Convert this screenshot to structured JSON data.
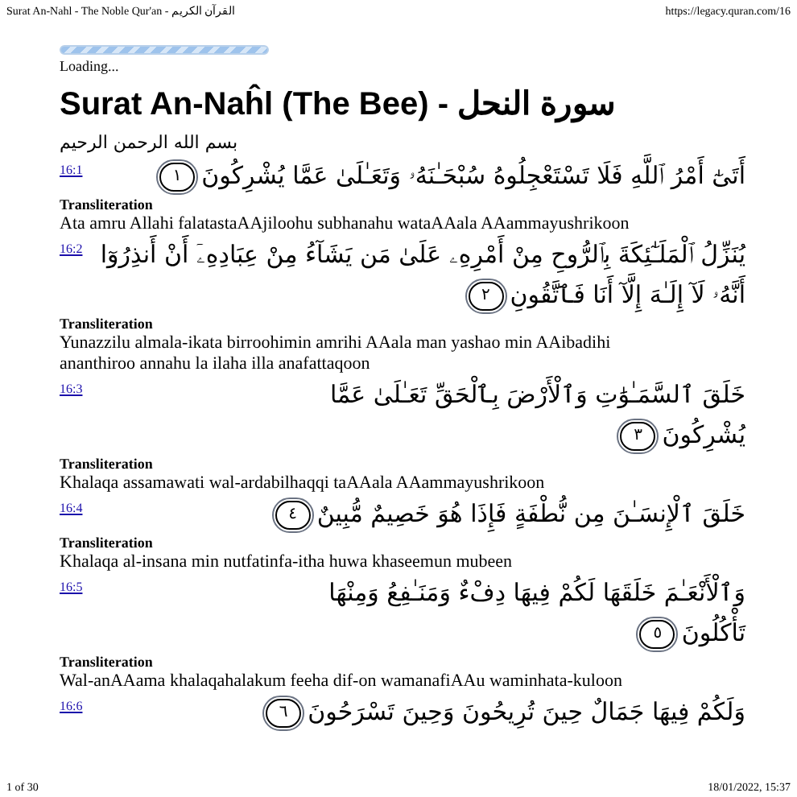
{
  "print_header": {
    "title": "Surat An-Nahl - The Noble Qur'an - القرآن الكريم",
    "url": "https://legacy.quran.com/16"
  },
  "loading": {
    "text": "Loading..."
  },
  "heading": {
    "title": "Surat An-Naĥl (The Bee) - سورة النحل"
  },
  "bismillah": "بسم الله الرحمن الرحيم",
  "verses": [
    {
      "ref": "16:1",
      "lines": [
        "أَتَىٰٓ أَمْرُ ٱللَّهِ فَلَا تَسْتَعْجِلُوهُ سُبْحَـٰنَهُۥ وَتَعَـٰلَىٰ عَمَّا يُشْرِكُونَ"
      ],
      "number": "١",
      "transliteration_label": "Transliteration",
      "transliteration": "Ata amru Allahi falatastaAAjiloohu subhanahu wataAAala AAammayushrikoon"
    },
    {
      "ref": "16:2",
      "lines": [
        "يُنَزِّلُ ٱلْمَلَـٰٓئِكَةَ بِٱلرُّوحِ مِنْ أَمْرِهِۦ عَلَىٰ مَن يَشَآءُ مِنْ عِبَادِهِۦٓ أَنْ أَنذِرُوٓا",
        "أَنَّهُۥ لَآ إِلَـٰهَ إِلَّآ أَنَا فَٱتَّقُونِ"
      ],
      "number": "٢",
      "transliteration_label": "Transliteration",
      "transliteration": "Yunazzilu almala-ikata birroohimin amrihi AAala man yashao min AAibadihi ananthiroo annahu la ilaha illa anafattaqoon"
    },
    {
      "ref": "16:3",
      "lines": [
        "خَلَقَ ٱلسَّمَـٰوَٰتِ وَٱلْأَرْضَ بِٱلْحَقِّ تَعَـٰلَىٰ عَمَّا",
        "يُشْرِكُونَ"
      ],
      "number": "٣",
      "transliteration_label": "Transliteration",
      "transliteration": "Khalaqa assamawati wal-ardabilhaqqi taAAala AAammayushrikoon"
    },
    {
      "ref": "16:4",
      "lines": [
        "خَلَقَ ٱلْإِنسَـٰنَ مِن نُّطْفَةٍ فَإِذَا هُوَ خَصِيمٌ مُّبِينٌ"
      ],
      "number": "٤",
      "transliteration_label": "Transliteration",
      "transliteration": "Khalaqa al-insana min nutfatinfa-itha huwa khaseemun mubeen"
    },
    {
      "ref": "16:5",
      "lines": [
        "وَٱلْأَنْعَـٰمَ خَلَقَهَا لَكُمْ فِيهَا دِفْءٌ وَمَنَـٰفِعُ وَمِنْهَا",
        "تَأْكُلُونَ"
      ],
      "number": "٥",
      "transliteration_label": "Transliteration",
      "transliteration": "Wal-anAAama khalaqahalakum feeha dif-on wamanafiAAu waminhata-kuloon"
    },
    {
      "ref": "16:6",
      "lines": [
        "وَلَكُمْ فِيهَا جَمَالٌ حِينَ تُرِيحُونَ وَحِينَ تَسْرَحُونَ"
      ],
      "number": "٦"
    }
  ],
  "print_footer": {
    "page": "1 of 30",
    "datetime": "18/01/2022, 15:37"
  }
}
